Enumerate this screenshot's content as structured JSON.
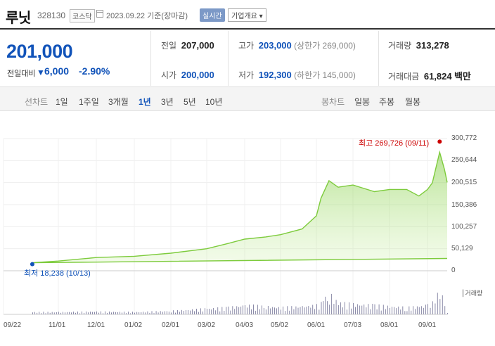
{
  "header": {
    "name": "루닛",
    "code": "328130",
    "market": "코스닥",
    "date": "2023.09.22 기준(장마감)",
    "realtime": "실시간",
    "overview": "기업개요"
  },
  "quote": {
    "price": "201,000",
    "change_label": "전일대비",
    "change_arrow": "▼",
    "change_amount": "6,000",
    "change_pct": "-2.90%",
    "prev_label": "전일",
    "prev": "207,000",
    "open_label": "시가",
    "open": "200,000",
    "high_label": "고가",
    "high": "203,000",
    "upper_limit": "(상한가 269,000)",
    "low_label": "저가",
    "low": "192,300",
    "lower_limit": "(하한가 145,000)",
    "volume_label": "거래량",
    "volume": "313,278",
    "value_label": "거래대금",
    "value": "61,824",
    "value_unit": "백만"
  },
  "periods": {
    "line_label": "선차트",
    "line_items": [
      "1일",
      "1주일",
      "3개월",
      "1년",
      "3년",
      "5년",
      "10년"
    ],
    "active": "1년",
    "candle_label": "봉차트",
    "candle_items": [
      "일봉",
      "주봉",
      "월봉"
    ]
  },
  "colors": {
    "accent": "#1153b9",
    "down": "#1153b9",
    "high_marker": "#cc0000",
    "line": "#7dcb3c",
    "fill": "#d6f3b7"
  },
  "chart_data": {
    "type": "area",
    "y_ticks": [
      "300,772",
      "250,644",
      "200,515",
      "150,386",
      "100,257",
      "50,129",
      "0"
    ],
    "ylim": [
      0,
      300772
    ],
    "x_ticks": [
      "09/22",
      "11/01",
      "12/01",
      "01/02",
      "02/01",
      "03/02",
      "04/03",
      "05/02",
      "06/01",
      "07/03",
      "08/01",
      "09/01"
    ],
    "high_annotation": "최고 269,726 (09/11)",
    "low_annotation": "최저 18,238 (10/13)",
    "volume_legend": "거래량",
    "x": [
      "09/22",
      "10/13",
      "11/01",
      "12/01",
      "01/02",
      "02/01",
      "03/02",
      "03/20",
      "04/03",
      "04/20",
      "05/02",
      "05/20",
      "06/01",
      "06/05",
      "06/12",
      "06/20",
      "07/03",
      "07/20",
      "08/01",
      "08/15",
      "08/25",
      "09/01",
      "09/05",
      "09/11",
      "09/15",
      "09/22"
    ],
    "values": [
      28000,
      18238,
      22000,
      30000,
      33000,
      40000,
      50000,
      62000,
      72000,
      77000,
      82000,
      95000,
      125000,
      165000,
      205000,
      190000,
      195000,
      180000,
      185000,
      185000,
      170000,
      185000,
      200000,
      269726,
      230000,
      201000
    ],
    "volume": [
      0.15,
      0.1,
      0.1,
      0.12,
      0.1,
      0.15,
      0.25,
      0.3,
      0.4,
      0.35,
      0.3,
      0.35,
      0.4,
      0.6,
      0.9,
      0.5,
      0.45,
      0.4,
      0.35,
      0.3,
      0.35,
      0.4,
      0.55,
      1.0,
      0.6,
      0.3
    ]
  }
}
